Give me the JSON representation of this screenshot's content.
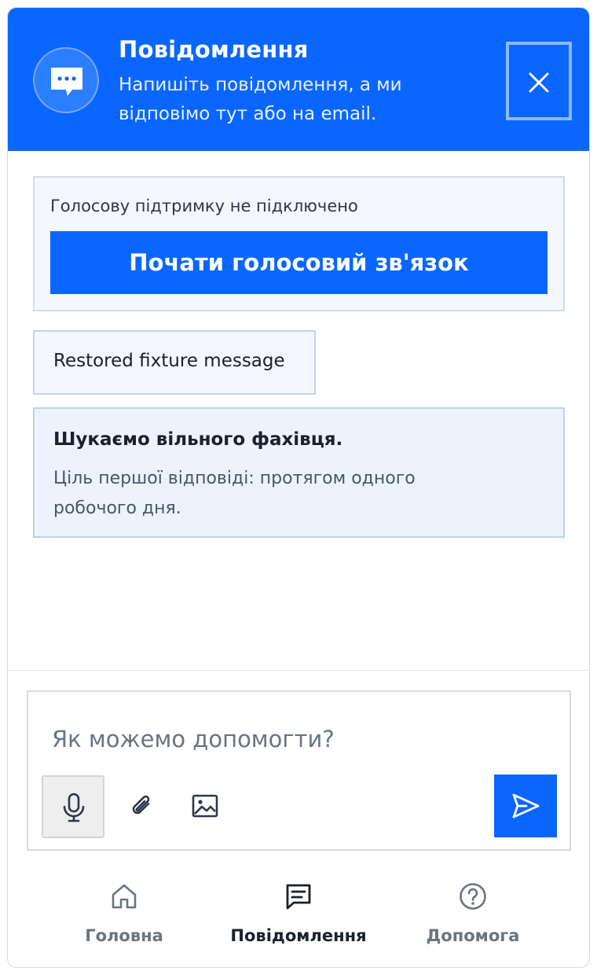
{
  "header": {
    "title": "Повідомлення",
    "subtitle": "Напишіть повідомлення, а ми відповімо тут або на email.",
    "avatar_icon": "chat-bubble-icon",
    "close_icon": "close-icon"
  },
  "voice": {
    "status": "Голосову підтримку не підключено",
    "button_label": "Почати голосовий зв'язок"
  },
  "messages": [
    {
      "text": "Restored fixture message"
    }
  ],
  "status_card": {
    "title": "Шукаємо вільного фахівця.",
    "text": "Ціль першої відповіді: протягом одного робочого дня."
  },
  "composer": {
    "placeholder": "Як можемо допомогти?",
    "value": "",
    "icons": [
      "microphone-icon",
      "paperclip-icon",
      "image-icon",
      "send-icon"
    ]
  },
  "nav": {
    "items": [
      {
        "label": "Головна",
        "icon": "home-icon",
        "active": false
      },
      {
        "label": "Повідомлення",
        "icon": "messages-icon",
        "active": true
      },
      {
        "label": "Допомога",
        "icon": "help-icon",
        "active": false
      }
    ]
  },
  "colors": {
    "accent": "#0a66ff",
    "card_bg": "#f4f8fc",
    "status_bg": "#edf3fd",
    "text_primary": "#1a202c",
    "text_muted": "#6b7480"
  }
}
